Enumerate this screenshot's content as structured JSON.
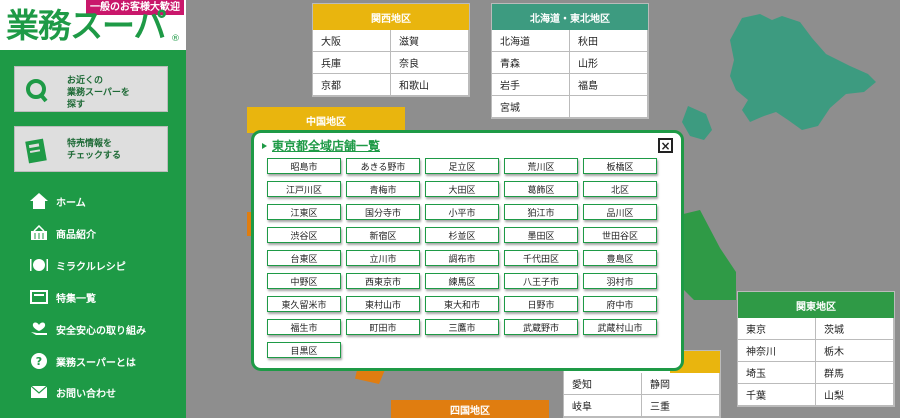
{
  "logo": {
    "tagline": "一般のお客様大歓迎",
    "brand": "業務スーパー",
    "reg": "®"
  },
  "sidebar": {
    "boxes": [
      {
        "label": "お近くの\n業務スーパーを\n探す",
        "icon": "search-icon"
      },
      {
        "label": "特売情報を\nチェックする",
        "icon": "flyer-icon"
      }
    ],
    "nav": [
      {
        "label": "ホーム",
        "icon": "home-icon"
      },
      {
        "label": "商品紹介",
        "icon": "basket-icon"
      },
      {
        "label": "ミラクルレシピ",
        "icon": "dish-icon"
      },
      {
        "label": "特集一覧",
        "icon": "list-icon"
      },
      {
        "label": "安全安心の取り組み",
        "icon": "safety-icon"
      },
      {
        "label": "業務スーパーとは",
        "icon": "question-icon"
      },
      {
        "label": "お問い合わせ",
        "icon": "mail-icon"
      }
    ]
  },
  "regions": {
    "kansai": {
      "title": "関西地区",
      "color": "#e9b50e",
      "prefs": [
        "大阪",
        "滋賀",
        "兵庫",
        "奈良",
        "京都",
        "和歌山"
      ]
    },
    "hokkaido": {
      "title": "北海道・東北地区",
      "color": "#3d9b80",
      "prefs": [
        "北海道",
        "秋田",
        "青森",
        "山形",
        "岩手",
        "福島",
        "宮城",
        ""
      ]
    },
    "chugoku": {
      "title": "中国地区",
      "color": "#e9b50e"
    },
    "kanto": {
      "title": "関東地区",
      "color": "#2f9a46",
      "prefs": [
        "東京",
        "茨城",
        "神奈川",
        "栃木",
        "埼玉",
        "群馬",
        "千葉",
        "山梨"
      ]
    },
    "chubu": {
      "prefs": [
        "愛知",
        "静岡",
        "岐阜",
        "三重"
      ]
    },
    "shikoku": {
      "title": "四国地区",
      "color": "#e07d10"
    }
  },
  "modal": {
    "title": "東京都全域店舗一覧",
    "close": "×",
    "stores": [
      "昭島市",
      "あきる野市",
      "足立区",
      "荒川区",
      "板橋区",
      "江戸川区",
      "青梅市",
      "大田区",
      "葛飾区",
      "北区",
      "江東区",
      "国分寺市",
      "小平市",
      "狛江市",
      "品川区",
      "渋谷区",
      "新宿区",
      "杉並区",
      "墨田区",
      "世田谷区",
      "台東区",
      "立川市",
      "調布市",
      "千代田区",
      "豊島区",
      "中野区",
      "西東京市",
      "練馬区",
      "八王子市",
      "羽村市",
      "東久留米市",
      "東村山市",
      "東大和市",
      "日野市",
      "府中市",
      "福生市",
      "町田市",
      "三鷹市",
      "武蔵野市",
      "武蔵村山市",
      "目黒区"
    ]
  }
}
